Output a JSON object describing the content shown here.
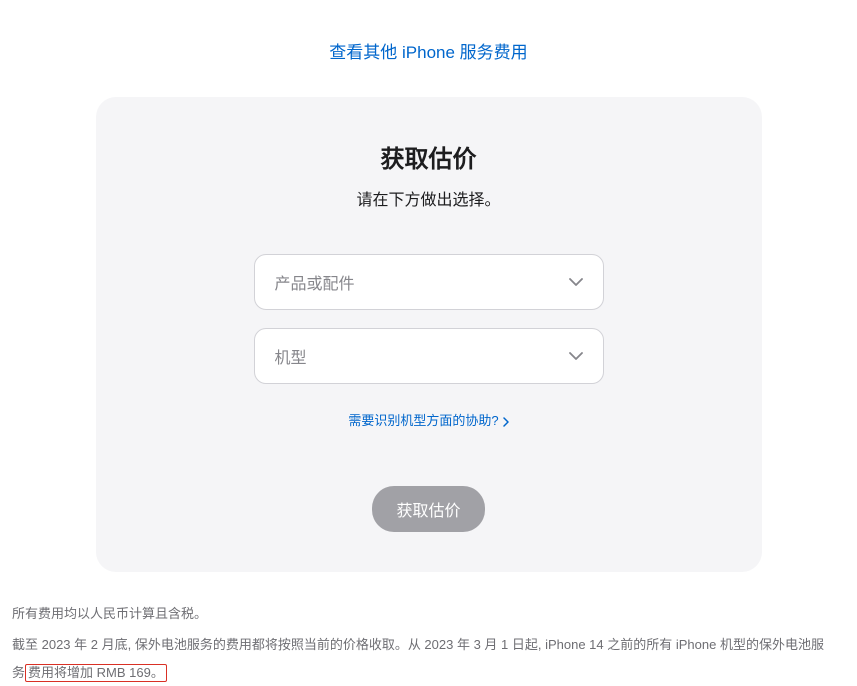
{
  "topLink": {
    "label": "查看其他 iPhone 服务费用"
  },
  "card": {
    "title": "获取估价",
    "subtitle": "请在下方做出选择。",
    "select1": {
      "placeholder": "产品或配件"
    },
    "select2": {
      "placeholder": "机型"
    },
    "helpLink": {
      "label": "需要识别机型方面的协助?"
    },
    "submitButton": {
      "label": "获取估价"
    }
  },
  "footer": {
    "line1": "所有费用均以人民币计算且含税。",
    "line2a": "截至 2023 年 2 月底, 保外电池服务的费用都将按照当前的价格收取。从 2023 年 3 月 1 日起, iPhone 14 之前的所有 iPhone 机型的保外电池服",
    "line2b_pre": "务",
    "line2b_highlight": "费用将增加 RMB 169。"
  }
}
